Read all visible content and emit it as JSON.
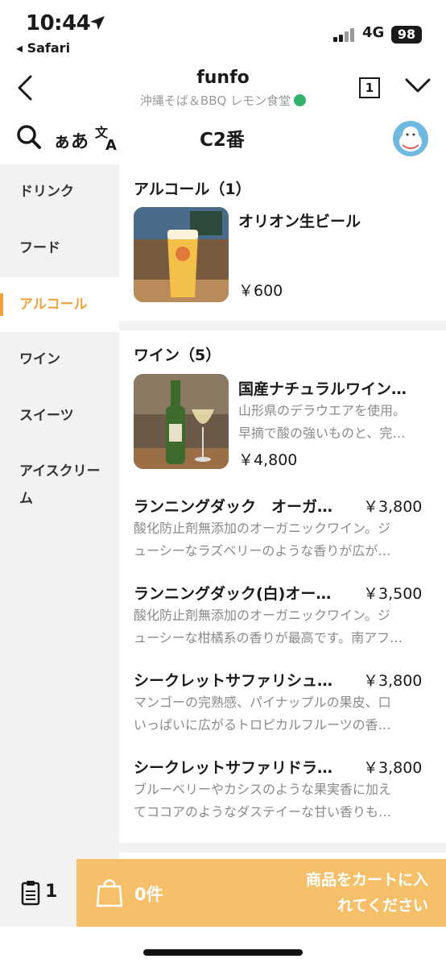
{
  "status_bar": {
    "time": "10:44",
    "back_app": "◂ Safari",
    "network": "4G",
    "battery": "98"
  },
  "header": {
    "title": "funfo",
    "subtitle": "沖縄そば＆BBQ レモン食堂",
    "table_count": "1"
  },
  "tools": {
    "kana_label": "ぁあ",
    "table_label": "C2番"
  },
  "sidebar": {
    "items": [
      {
        "label": "ドリンク"
      },
      {
        "label": "フード"
      },
      {
        "label": "アルコール"
      },
      {
        "label": "ワイン"
      },
      {
        "label": "スイーツ"
      },
      {
        "label": "アイスクリー\nム"
      }
    ],
    "active_index": 2
  },
  "sections": {
    "alcohol": {
      "title": "アルコール（1）",
      "items": [
        {
          "name": "オリオン生ビール",
          "price": "￥600"
        }
      ]
    },
    "wine": {
      "title": "ワイン（5）",
      "items": [
        {
          "name": "国産ナチュラルワイン…",
          "desc": "山形県のデラウエアを使用。\n早摘で酸の強いものと、完…",
          "price": "￥4,800"
        },
        {
          "name": "ランニングダック　オーガ…",
          "desc": "酸化防止剤無添加のオーガニックワイン。ジ\nューシーなラズベリーのような香りが広が…",
          "price": "￥3,800"
        },
        {
          "name": "ランニングダック(白)オー…",
          "desc": "酸化防止剤無添加のオーガニックワイン。ジ\nューシーな柑橘系の香りが最高です。南アフ…",
          "price": "￥3,500"
        },
        {
          "name": "シークレットサファリシュ…",
          "desc": "マンゴーの完熟感、パイナップルの果皮、口\nいっぱいに広がるトロピカルフルーツの香…",
          "price": "￥3,800"
        },
        {
          "name": "シークレットサファリドラ…",
          "desc": "ブルーベリーやカシスのような果実香に加え\nてココアのようなダステイーな甘い香りも…",
          "price": "￥3,800"
        }
      ]
    }
  },
  "bottom_bar": {
    "order_count": "1",
    "cart_count": "0件",
    "cart_message": "商品をカートに入れてください"
  },
  "colors": {
    "accent": "#f0a33a",
    "cart_bg": "#f6c06a",
    "sidebar_bg": "#f2f2f2"
  }
}
